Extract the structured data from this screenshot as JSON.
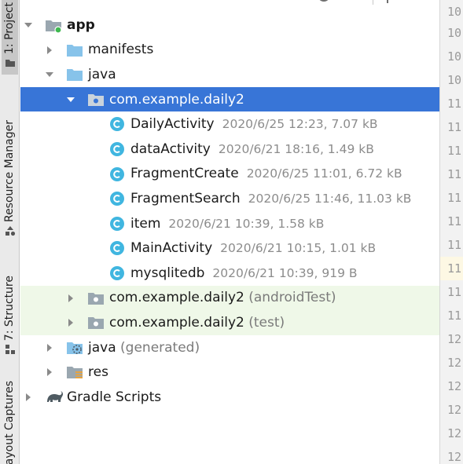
{
  "side_tabs": {
    "project": "1: Project",
    "resource_manager": "Resource Manager",
    "structure": "7: Structure",
    "captures": "Layout Captures"
  },
  "tree": [
    {
      "label": "app",
      "bold": true,
      "expanded": true,
      "icon": "module-icon"
    },
    {
      "label": "manifests",
      "expanded": false,
      "icon": "folder-icon"
    },
    {
      "label": "java",
      "expanded": true,
      "icon": "folder-icon"
    },
    {
      "label": "com.example.daily2",
      "expanded": true,
      "icon": "package-icon",
      "selected": true
    },
    {
      "label": "DailyActivity",
      "meta": "2020/6/25 12:23, 7.07 kB",
      "icon": "class-icon"
    },
    {
      "label": "dataActivity",
      "meta": "2020/6/21 18:16, 1.49 kB",
      "icon": "class-icon"
    },
    {
      "label": "FragmentCreate",
      "meta": "2020/6/25 11:01, 6.72 kB",
      "icon": "class-icon"
    },
    {
      "label": "FragmentSearch",
      "meta": "2020/6/25 11:46, 11.03 kB",
      "icon": "class-icon"
    },
    {
      "label": "item",
      "meta": "2020/6/21 10:39, 1.58 kB",
      "icon": "class-icon"
    },
    {
      "label": "MainActivity",
      "meta": "2020/6/21 10:15, 1.01 kB",
      "icon": "class-icon"
    },
    {
      "label": "mysqlitedb",
      "meta": "2020/6/21 10:39, 919 B",
      "icon": "class-icon"
    },
    {
      "label": "com.example.daily2",
      "suffix": "(androidTest)",
      "expanded": false,
      "icon": "package-icon"
    },
    {
      "label": "com.example.daily2",
      "suffix": "(test)",
      "expanded": false,
      "icon": "package-icon"
    },
    {
      "label": "java",
      "suffix": "(generated)",
      "expanded": false,
      "icon": "generated-folder-icon"
    },
    {
      "label": "res",
      "expanded": false,
      "icon": "res-folder-icon"
    },
    {
      "label": "Gradle Scripts",
      "expanded": false,
      "icon": "gradle-icon"
    }
  ],
  "gutter_lines": [
    "10",
    "10",
    "10",
    "10",
    "11",
    "11",
    "11",
    "11",
    "11",
    "11",
    "11",
    "11",
    "11",
    "11",
    "12",
    "12",
    "12",
    "12",
    "12",
    "12"
  ],
  "colors": {
    "selection": "#3875d7",
    "folder": "#87c3ea",
    "package": "#9aa7b0",
    "class": "#40b6e0",
    "test_bg": "#eff8e8"
  }
}
